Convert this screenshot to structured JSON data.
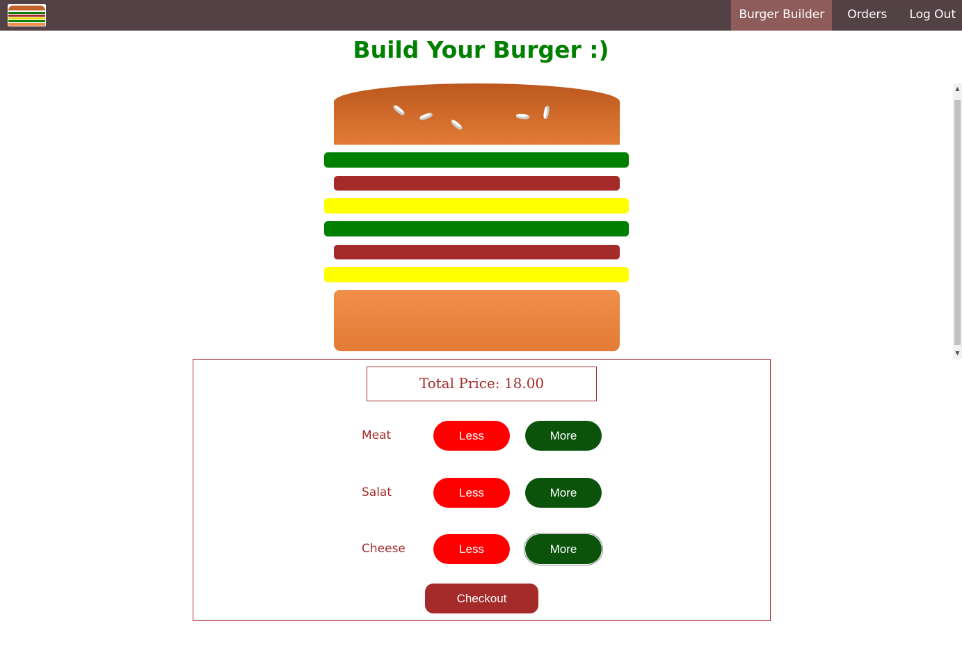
{
  "navbar": {
    "logo": "burger-logo",
    "links": [
      {
        "label": "Burger Builder",
        "active": true
      },
      {
        "label": "Orders",
        "active": false
      },
      {
        "label": "Log Out",
        "active": false
      }
    ]
  },
  "page_title": "Build Your Burger :)",
  "burger": {
    "layers": [
      "bread-top",
      "salad",
      "meat",
      "cheese",
      "salad",
      "meat",
      "cheese",
      "bread-bottom"
    ],
    "colors": {
      "salad": "#008000",
      "meat": "#a52a2a",
      "cheese": "#ffff00",
      "nav": "#524145",
      "active_nav": "#8f5c5c"
    }
  },
  "controls": {
    "price_label": "Total Price: 18.00",
    "rows": [
      {
        "label": "Meat",
        "less": "Less",
        "more": "More"
      },
      {
        "label": "Salat",
        "less": "Less",
        "more": "More"
      },
      {
        "label": "Cheese",
        "less": "Less",
        "more": "More"
      }
    ],
    "checkout_label": "Checkout"
  }
}
